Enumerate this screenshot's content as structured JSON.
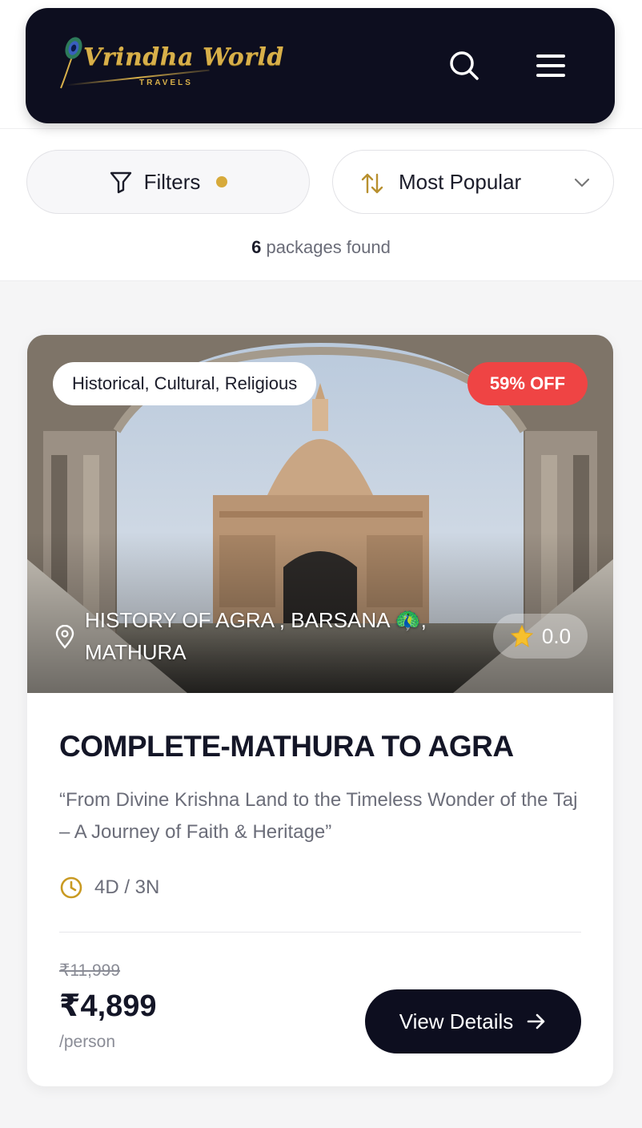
{
  "header": {
    "logo_text": "Vrindha World",
    "logo_subtext": "TRAVELS",
    "icons": [
      "search-icon",
      "menu-icon"
    ]
  },
  "toolbar": {
    "filters_label": "Filters",
    "filters_active_color": "#d7aa3b",
    "sort_label": "Most Popular"
  },
  "results": {
    "count": "6",
    "count_suffix": "packages found"
  },
  "packages": [
    {
      "category": "Historical, Cultural, Religious",
      "discount": "59% OFF",
      "location": "HISTORY OF AGRA , BARSANA 🦚, MATHURA",
      "rating": "0.0",
      "title": "COMPLETE-MATHURA TO AGRA",
      "tagline": "“From Divine Krishna Land to the Timeless Wonder of the Taj – A Journey of Faith & Heritage”",
      "duration": "4D / 3N",
      "original_price": "₹11,999",
      "price": "₹4,899",
      "price_unit": "/person",
      "cta_label": "View Details"
    }
  ],
  "colors": {
    "navbar_bg": "#0d0e1f",
    "accent_gold": "#d7aa3b",
    "discount_red": "#ef4444"
  }
}
